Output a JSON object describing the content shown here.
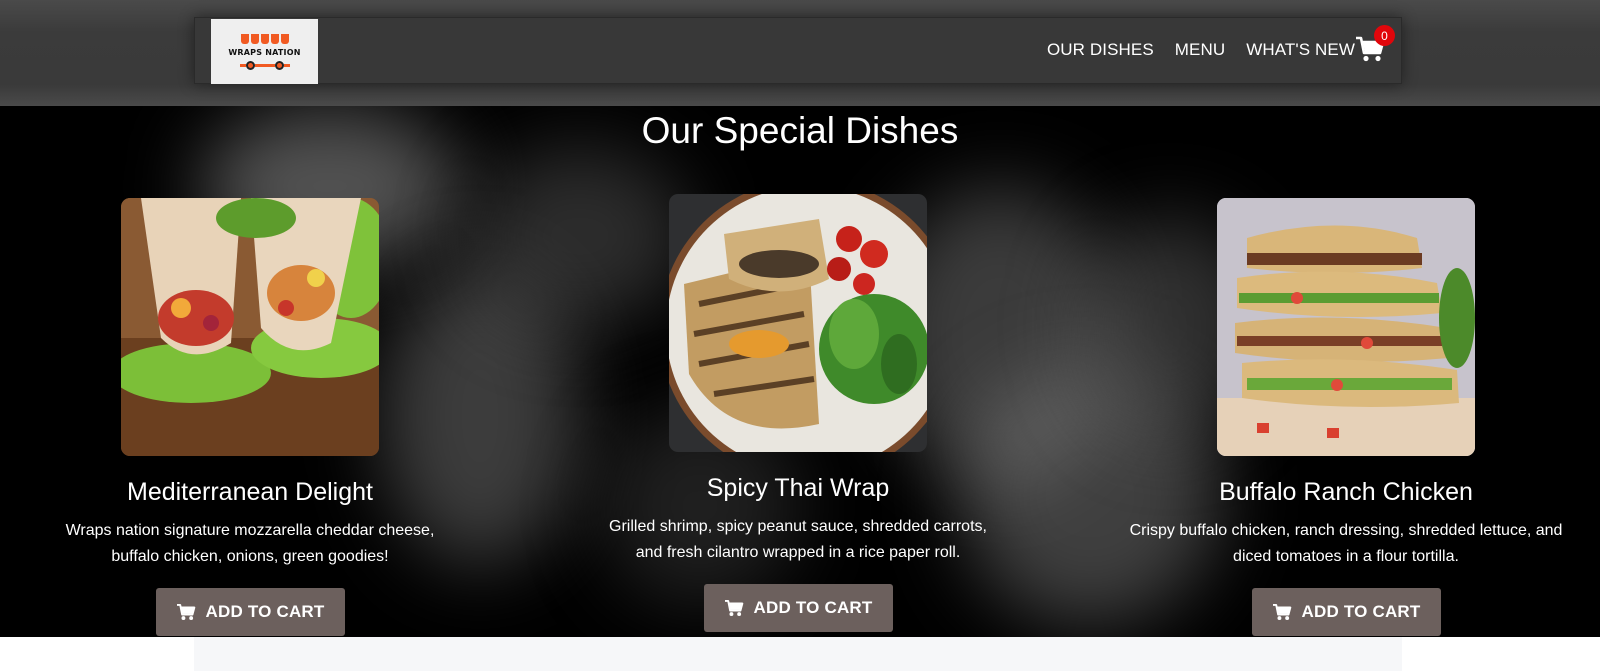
{
  "brand": {
    "logo_text": "WRAPS NATION",
    "accent": "#f15a22"
  },
  "nav": {
    "links": [
      "OUR DISHES",
      "MENU",
      "WHAT'S NEW"
    ],
    "cart_icon": "shopping-cart-icon",
    "cart_count": "0",
    "badge_color": "#e1060b"
  },
  "hero": {
    "title": "Our Special Dishes"
  },
  "dishes": [
    {
      "name": "Mediterranean Delight",
      "description": "Wraps nation signature mozzarella cheddar cheese, buffalo chicken, onions, green goodies!",
      "button_label": "ADD TO CART",
      "button_icon": "cart-icon"
    },
    {
      "name": "Spicy Thai Wrap",
      "description": "Grilled shrimp, spicy peanut sauce, shredded carrots, and fresh cilantro wrapped in a rice paper roll.",
      "button_label": "ADD TO CART",
      "button_icon": "cart-icon"
    },
    {
      "name": "Buffalo Ranch Chicken",
      "description": "Crispy buffalo chicken, ranch dressing, shredded lettuce, and diced tomatoes in a flour tortilla.",
      "button_label": "ADD TO CART",
      "button_icon": "cart-icon"
    }
  ],
  "colors": {
    "button_bg": "#6c605d",
    "header_bg": "#383838"
  }
}
